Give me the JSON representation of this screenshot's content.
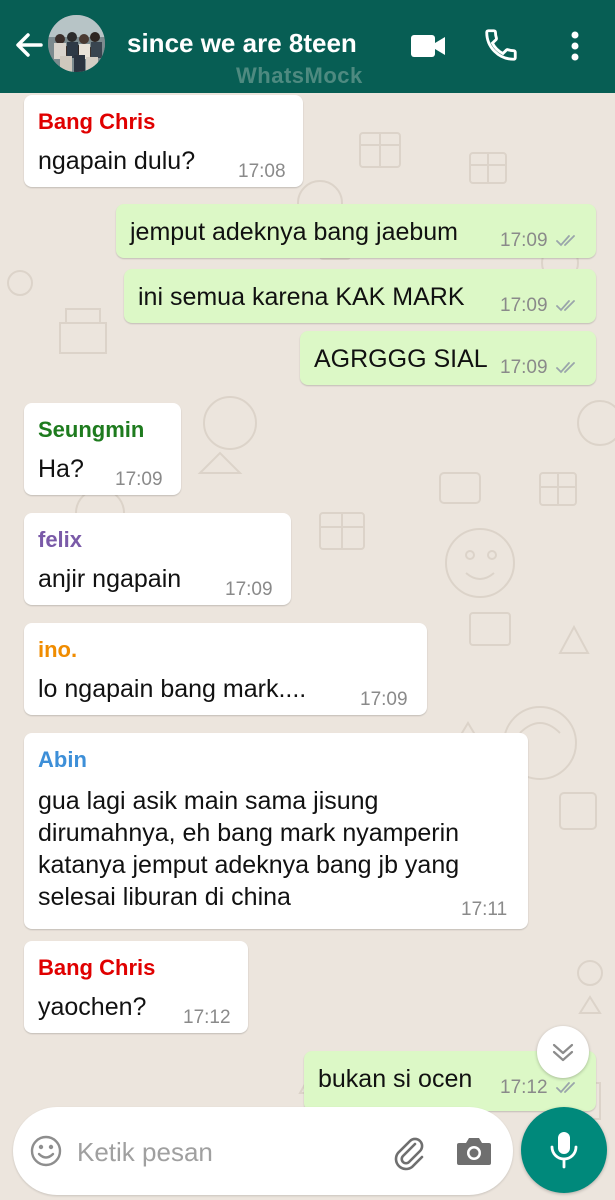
{
  "header": {
    "title": "since we are 8teen",
    "watermark": "WhatsMock",
    "color": "#075e54",
    "icons": {
      "back": "arrow-left-icon",
      "video": "video-camera-icon",
      "call": "phone-icon",
      "menu": "more-vert-icon"
    }
  },
  "messages": [
    {
      "direction": "in",
      "sender": "Bang Chris",
      "sender_color": "#e00000",
      "lines": [
        "ngapain dulu?"
      ],
      "time": "17:08"
    },
    {
      "direction": "out",
      "lines": [
        "jemput adeknya bang jaebum"
      ],
      "time": "17:09",
      "status": "read-ticks"
    },
    {
      "direction": "out",
      "lines": [
        "ini semua karena KAK MARK"
      ],
      "time": "17:09",
      "status": "read-ticks"
    },
    {
      "direction": "out",
      "lines": [
        "AGRGGG SIAL"
      ],
      "time": "17:09",
      "status": "read-ticks"
    },
    {
      "direction": "in",
      "sender": "Seungmin",
      "sender_color": "#1e7b1e",
      "lines": [
        "Ha?"
      ],
      "time": "17:09"
    },
    {
      "direction": "in",
      "sender": "felix",
      "sender_color": "#7a5aa8",
      "lines": [
        "anjir ngapain"
      ],
      "time": "17:09"
    },
    {
      "direction": "in",
      "sender": "ino.",
      "sender_color": "#f08c00",
      "lines": [
        "lo ngapain bang mark...."
      ],
      "time": "17:09"
    },
    {
      "direction": "in",
      "sender": "Abin",
      "sender_color": "#3d8fd8",
      "lines": [
        "gua lagi asik main sama jisung",
        "dirumahnya, eh bang mark nyamperin",
        "katanya jemput adeknya bang jb yang",
        "selesai liburan di china"
      ],
      "time": "17:11"
    },
    {
      "direction": "in",
      "sender": "Bang Chris",
      "sender_color": "#e00000",
      "lines": [
        "yaochen?"
      ],
      "time": "17:12"
    },
    {
      "direction": "out",
      "lines": [
        "bukan si ocen"
      ],
      "time": "17:12",
      "status": "read-ticks"
    }
  ],
  "input": {
    "placeholder": "Ketik pesan",
    "icons": {
      "emoji": "emoji-smile-icon",
      "attach": "paperclip-icon",
      "camera": "camera-icon",
      "mic": "microphone-icon",
      "scroll": "chevron-double-down-icon"
    },
    "mic_color": "#00897b"
  },
  "colors": {
    "chat_background": "#ece5dd",
    "incoming_bubble": "#ffffff",
    "outgoing_bubble": "#dcf8c6",
    "read_ticks": "#9aa5ab"
  }
}
